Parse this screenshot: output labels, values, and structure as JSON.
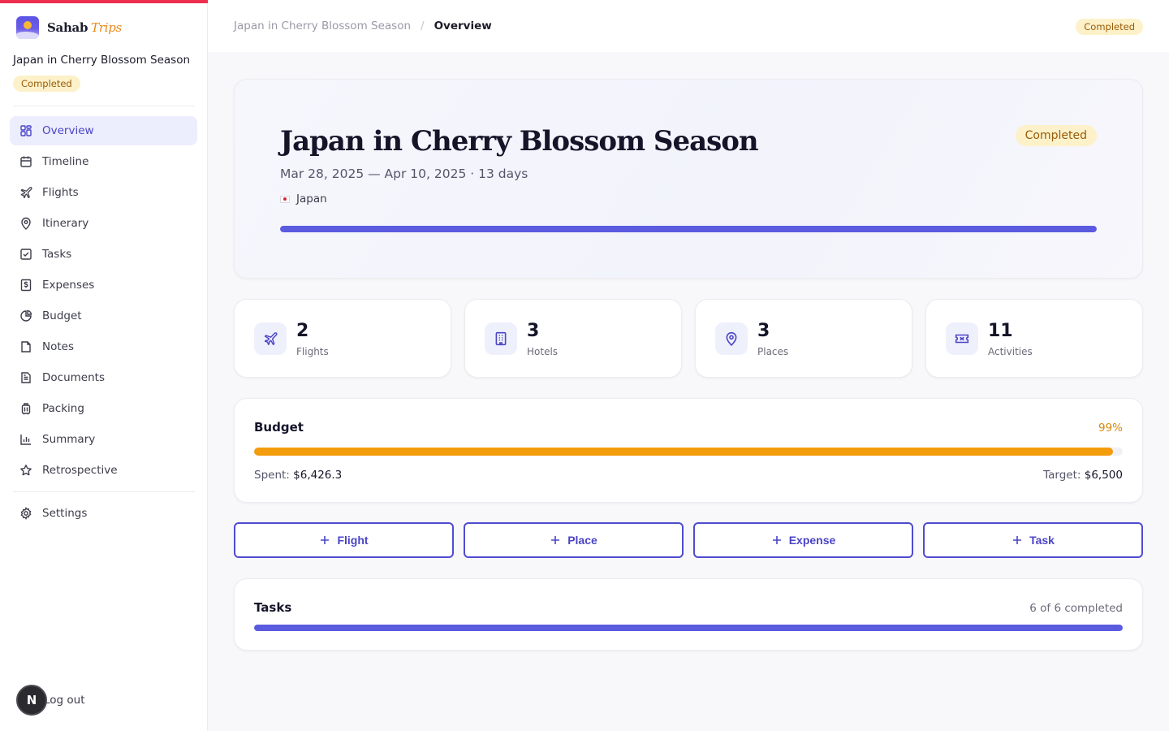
{
  "brand": {
    "name": "Sahab",
    "accent": "Trips"
  },
  "trip": {
    "title": "Japan in Cherry Blossom Season",
    "status": "Completed",
    "dates": "Mar 28, 2025 — Apr 10, 2025 · 13 days",
    "country": "Japan",
    "progress_fraction": 1.0
  },
  "sidebar": {
    "items": [
      {
        "label": "Overview",
        "icon": "grid-icon",
        "active": true
      },
      {
        "label": "Timeline",
        "icon": "calendar-icon"
      },
      {
        "label": "Flights",
        "icon": "plane-icon"
      },
      {
        "label": "Itinerary",
        "icon": "map-pin-icon"
      },
      {
        "label": "Tasks",
        "icon": "checkbox-icon"
      },
      {
        "label": "Expenses",
        "icon": "receipt-dollar-icon"
      },
      {
        "label": "Budget",
        "icon": "pie-chart-icon"
      },
      {
        "label": "Notes",
        "icon": "note-icon"
      },
      {
        "label": "Documents",
        "icon": "document-icon"
      },
      {
        "label": "Packing",
        "icon": "luggage-icon"
      },
      {
        "label": "Summary",
        "icon": "bar-chart-icon"
      },
      {
        "label": "Retrospective",
        "icon": "star-icon"
      }
    ],
    "settings": "Settings",
    "logout": "Log out",
    "avatar_initial": "N"
  },
  "header": {
    "breadcrumb_parent": "Japan in Cherry Blossom Season",
    "breadcrumb_separator": "/",
    "breadcrumb_current": "Overview",
    "status": "Completed"
  },
  "stats": [
    {
      "value": "2",
      "label": "Flights",
      "icon": "plane-icon"
    },
    {
      "value": "3",
      "label": "Hotels",
      "icon": "building-icon"
    },
    {
      "value": "3",
      "label": "Places",
      "icon": "map-pin-icon"
    },
    {
      "value": "11",
      "label": "Activities",
      "icon": "ticket-icon"
    }
  ],
  "budget": {
    "title": "Budget",
    "percent_label": "99%",
    "spent_fraction": 0.9887,
    "spent_prefix": "Spent:",
    "spent_value": "$6,426.3",
    "target_prefix": "Target:",
    "target_value": "$6,500"
  },
  "quick_actions": [
    "Flight",
    "Place",
    "Expense",
    "Task"
  ],
  "tasks": {
    "title": "Tasks",
    "count_label": "6 of 6 completed",
    "completed_fraction": 1.0
  },
  "colors": {
    "brand_red": "#ee2e4d",
    "accent_indigo": "#5b5be0",
    "budget_orange": "#f39c0c",
    "badge_bg": "#fdf1c9",
    "badge_text": "#9a5b08"
  }
}
